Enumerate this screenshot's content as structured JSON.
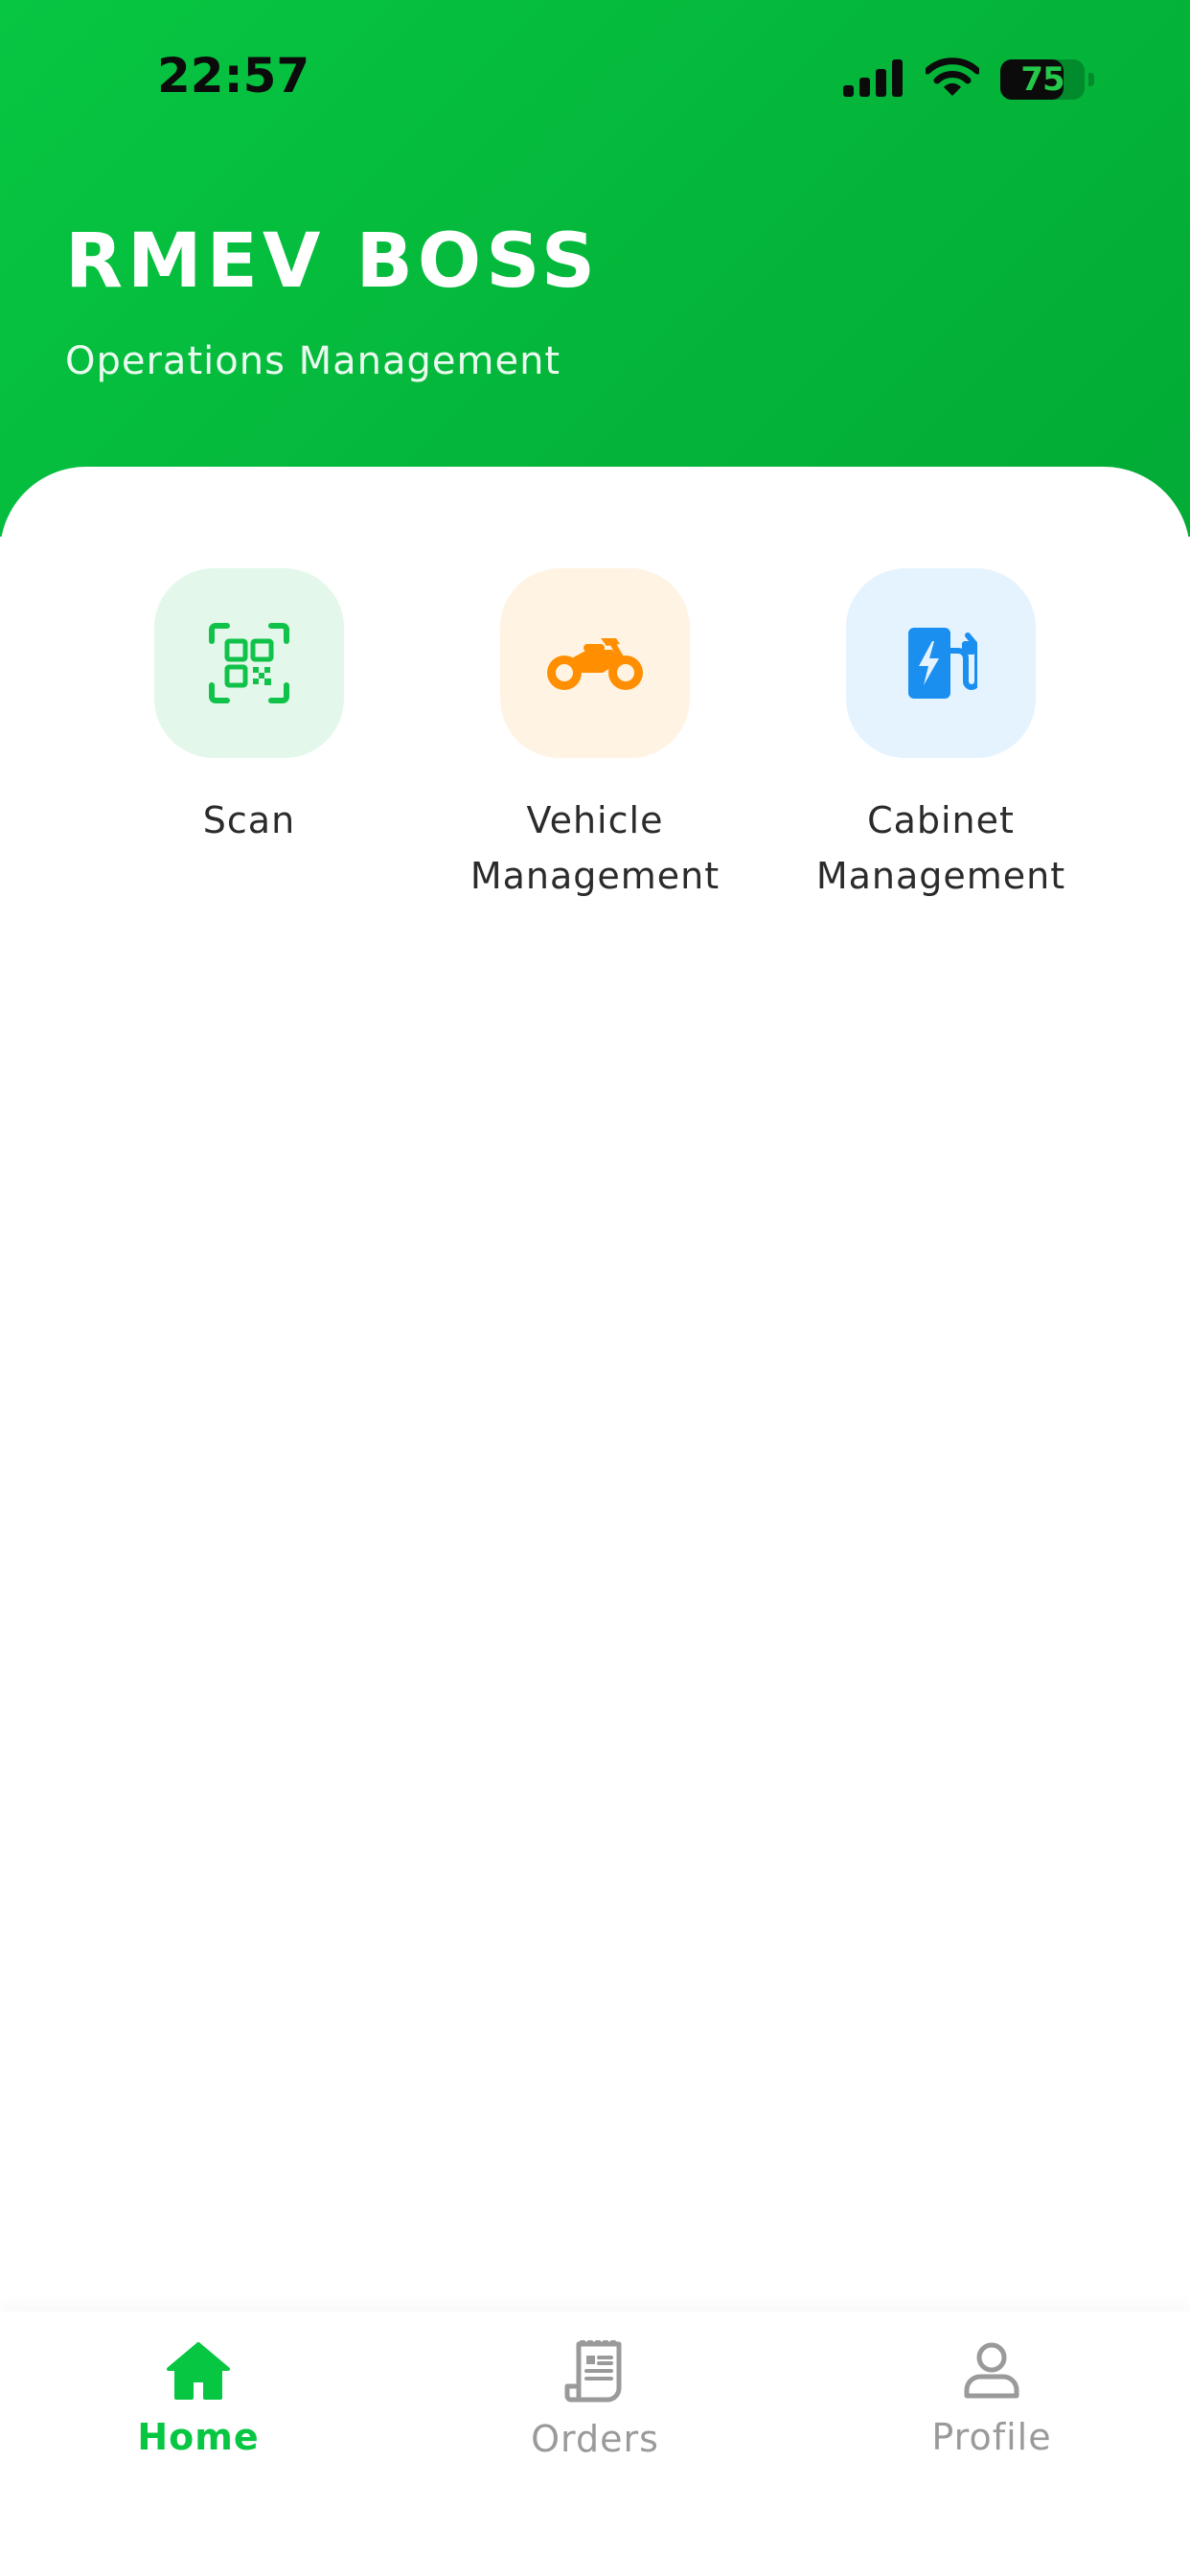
{
  "status_bar": {
    "time": "22:57",
    "battery": "75",
    "battery_level": 0.75,
    "icons": [
      "signal-icon",
      "wifi-icon",
      "battery-icon"
    ]
  },
  "header": {
    "title": "RMEV BOSS",
    "subtitle": "Operations Management"
  },
  "menu": {
    "items": [
      {
        "label": "Scan",
        "icon": "qr-scan-icon",
        "tile_color": "#e3f8ea",
        "icon_color": "#11c24a"
      },
      {
        "label": "Vehicle Management",
        "icon": "motorcycle-icon",
        "tile_color": "#fff3e3",
        "icon_color": "#ff8f00"
      },
      {
        "label": "Cabinet Management",
        "icon": "charging-station-icon",
        "tile_color": "#e5f3ff",
        "icon_color": "#1a8ff0"
      }
    ]
  },
  "tabbar": {
    "tabs": [
      {
        "label": "Home",
        "icon": "home-icon",
        "active": true
      },
      {
        "label": "Orders",
        "icon": "receipt-icon",
        "active": false
      },
      {
        "label": "Profile",
        "icon": "user-icon",
        "active": false
      }
    ],
    "active_color": "#07c642",
    "inactive_color": "#9a9a9a"
  },
  "colors": {
    "header_start": "#07c642",
    "header_end": "#02ab35"
  }
}
